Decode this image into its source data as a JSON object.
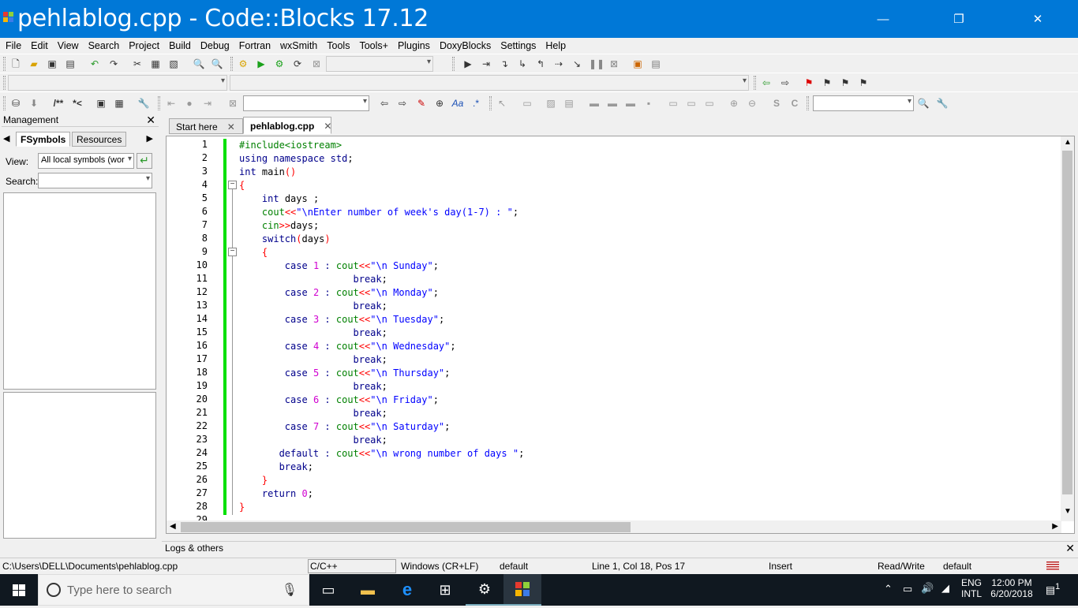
{
  "window": {
    "title": "pehlablog.cpp - Code::Blocks 17.12",
    "minimize_glyph": "—",
    "maximize_glyph": "❐",
    "close_glyph": "✕"
  },
  "menu": [
    "File",
    "Edit",
    "View",
    "Search",
    "Project",
    "Build",
    "Debug",
    "Fortran",
    "wxSmith",
    "Tools",
    "Tools+",
    "Plugins",
    "DoxyBlocks",
    "Settings",
    "Help"
  ],
  "toolbar3": {
    "doxy_comment": "/**",
    "doxy_line": "*<",
    "regex_label": ".*"
  },
  "management": {
    "title": "Management",
    "tabs": [
      "FSymbols",
      "Resources"
    ],
    "view_label": "View:",
    "view_value": "All local symbols (wor",
    "search_label": "Search:",
    "search_value": ""
  },
  "editor": {
    "tabs": [
      {
        "label": "Start here"
      },
      {
        "label": "pehlablog.cpp"
      }
    ],
    "line_numbers": [
      "1",
      "2",
      "3",
      "4",
      "5",
      "6",
      "7",
      "8",
      "9",
      "10",
      "11",
      "12",
      "13",
      "14",
      "15",
      "16",
      "17",
      "18",
      "19",
      "20",
      "21",
      "22",
      "23",
      "24",
      "25",
      "26",
      "27",
      "28",
      "29"
    ]
  },
  "logs_title": "Logs & others",
  "status": {
    "path": "C:\\Users\\DELL\\Documents\\pehlablog.cpp",
    "language": "C/C++",
    "eol": "Windows (CR+LF)",
    "encoding": "default",
    "position": "Line 1, Col 18, Pos 17",
    "mode": "Insert",
    "access": "Read/Write",
    "profile": "default"
  },
  "taskbar": {
    "search_placeholder": "Type here to search",
    "lang1": "ENG",
    "lang2": "INTL",
    "time": "12:00 PM",
    "date": "6/20/2018",
    "notifications": "1"
  },
  "colors": {
    "titlebar": "#0078d7",
    "keyword": "#00008b",
    "string": "#0000ff",
    "number": "#d000d0",
    "preprocessor": "#008000",
    "changebar": "#00e000"
  }
}
